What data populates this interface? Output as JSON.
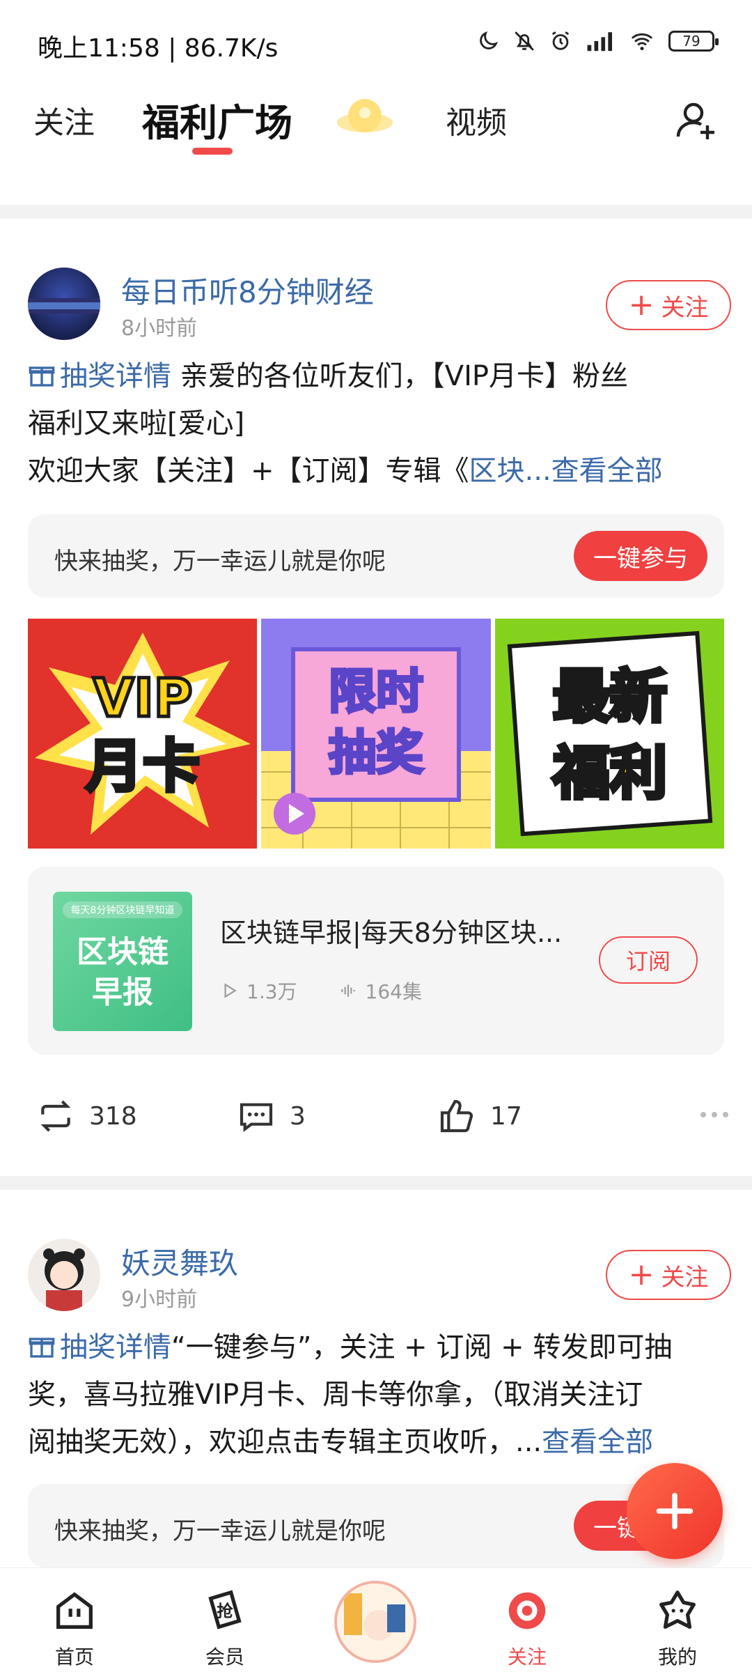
{
  "status_bar": {
    "time": "晚上11:58 | 86.7K/s",
    "battery": "79"
  },
  "top_nav": {
    "tabs": [
      "关注",
      "福利广场",
      "视频"
    ],
    "active_tab": "福利广场"
  },
  "posts": [
    {
      "author": "每日币听8分钟财经",
      "time": "8小时前",
      "follow_label": "关注",
      "lottery_tag": "抽奖详情",
      "text_line1": " 亲爱的各位听友们，【VIP月卡】粉丝",
      "text_line2": "福利又来啦[爱心]",
      "text_line3": "欢迎大家【关注】+【订阅】专辑《",
      "text_link": "区块...",
      "see_all": "查看全部",
      "lottery_prompt": "快来抽奖，万一幸运儿就是你呢",
      "join_label": "一键参与",
      "images": [
        {
          "line1": "VIP",
          "line2": "月卡"
        },
        {
          "line1": "限时",
          "line2": "抽奖"
        },
        {
          "line1": "最新",
          "line2": "福利"
        }
      ],
      "album": {
        "cover_tag": "每天8分钟区块链早知道",
        "cover_line1": "区块链",
        "cover_line2": "早报",
        "title": "区块链早报|每天8分钟区块...",
        "plays": "1.3万",
        "episodes": "164集",
        "subscribe_label": "订阅"
      },
      "reposts": "318",
      "comments": "3",
      "likes": "17"
    },
    {
      "author": "妖灵舞玖",
      "time": "9小时前",
      "follow_label": "关注",
      "lottery_tag": "抽奖详情",
      "text_line1": "“一键参与”，关注 + 订阅 + 转发即可抽",
      "text_line2": "奖，喜马拉雅VIP月卡、周卡等你拿，（取消关注订",
      "text_line3": "阅抽奖无效），欢迎点击专辑主页收听，...",
      "see_all": "查看全部",
      "lottery_prompt": "快来抽奖，万一幸运儿就是你呢",
      "join_label": "一键参与"
    }
  ],
  "bottom_nav": [
    {
      "label": "首页",
      "icon": "home-icon"
    },
    {
      "label": "会员",
      "icon": "member-icon"
    },
    {
      "label": "",
      "icon": "center-avatar"
    },
    {
      "label": "关注",
      "icon": "follow-icon"
    },
    {
      "label": "我的",
      "icon": "profile-icon"
    }
  ],
  "colors": {
    "accent": "#f04a4a",
    "link": "#3b6aa8"
  }
}
